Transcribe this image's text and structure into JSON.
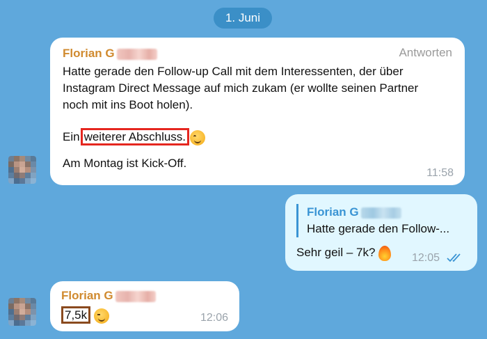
{
  "date_separator": "1. Juni",
  "messages": [
    {
      "direction": "in",
      "sender": "Florian G",
      "reply_label": "Antworten",
      "line1": "Hatte gerade den Follow-up Call mit dem Interessenten, der über",
      "line2": "Instagram Direct Message auf mich zukam (er wollte seinen Partner",
      "line3": "noch mit ins Boot holen).",
      "line4_prefix": "Ein",
      "line4_highlight": "weiterer Abschluss.",
      "line4_emoji": "smiling-face-icon",
      "line5": "Am Montag ist Kick-Off.",
      "time": "11:58"
    },
    {
      "direction": "out",
      "quoted_sender": "Florian G",
      "quoted_text": "Hatte gerade den Follow-...",
      "text": "Sehr geil – 7k?",
      "emoji": "fire-icon",
      "time": "12:05",
      "status": "read-double-check-icon"
    },
    {
      "direction": "in",
      "sender": "Florian G",
      "highlight": "7,5k",
      "emoji": "winking-face-icon",
      "time": "12:06"
    }
  ],
  "colors": {
    "background": "#5fa8dc",
    "sender_name": "#d08a2f",
    "quote_accent": "#3a94d4",
    "highlight_red": "#e5261f",
    "highlight_brown": "#8a4a1e",
    "outgoing_bubble": "#e1f7ff"
  }
}
